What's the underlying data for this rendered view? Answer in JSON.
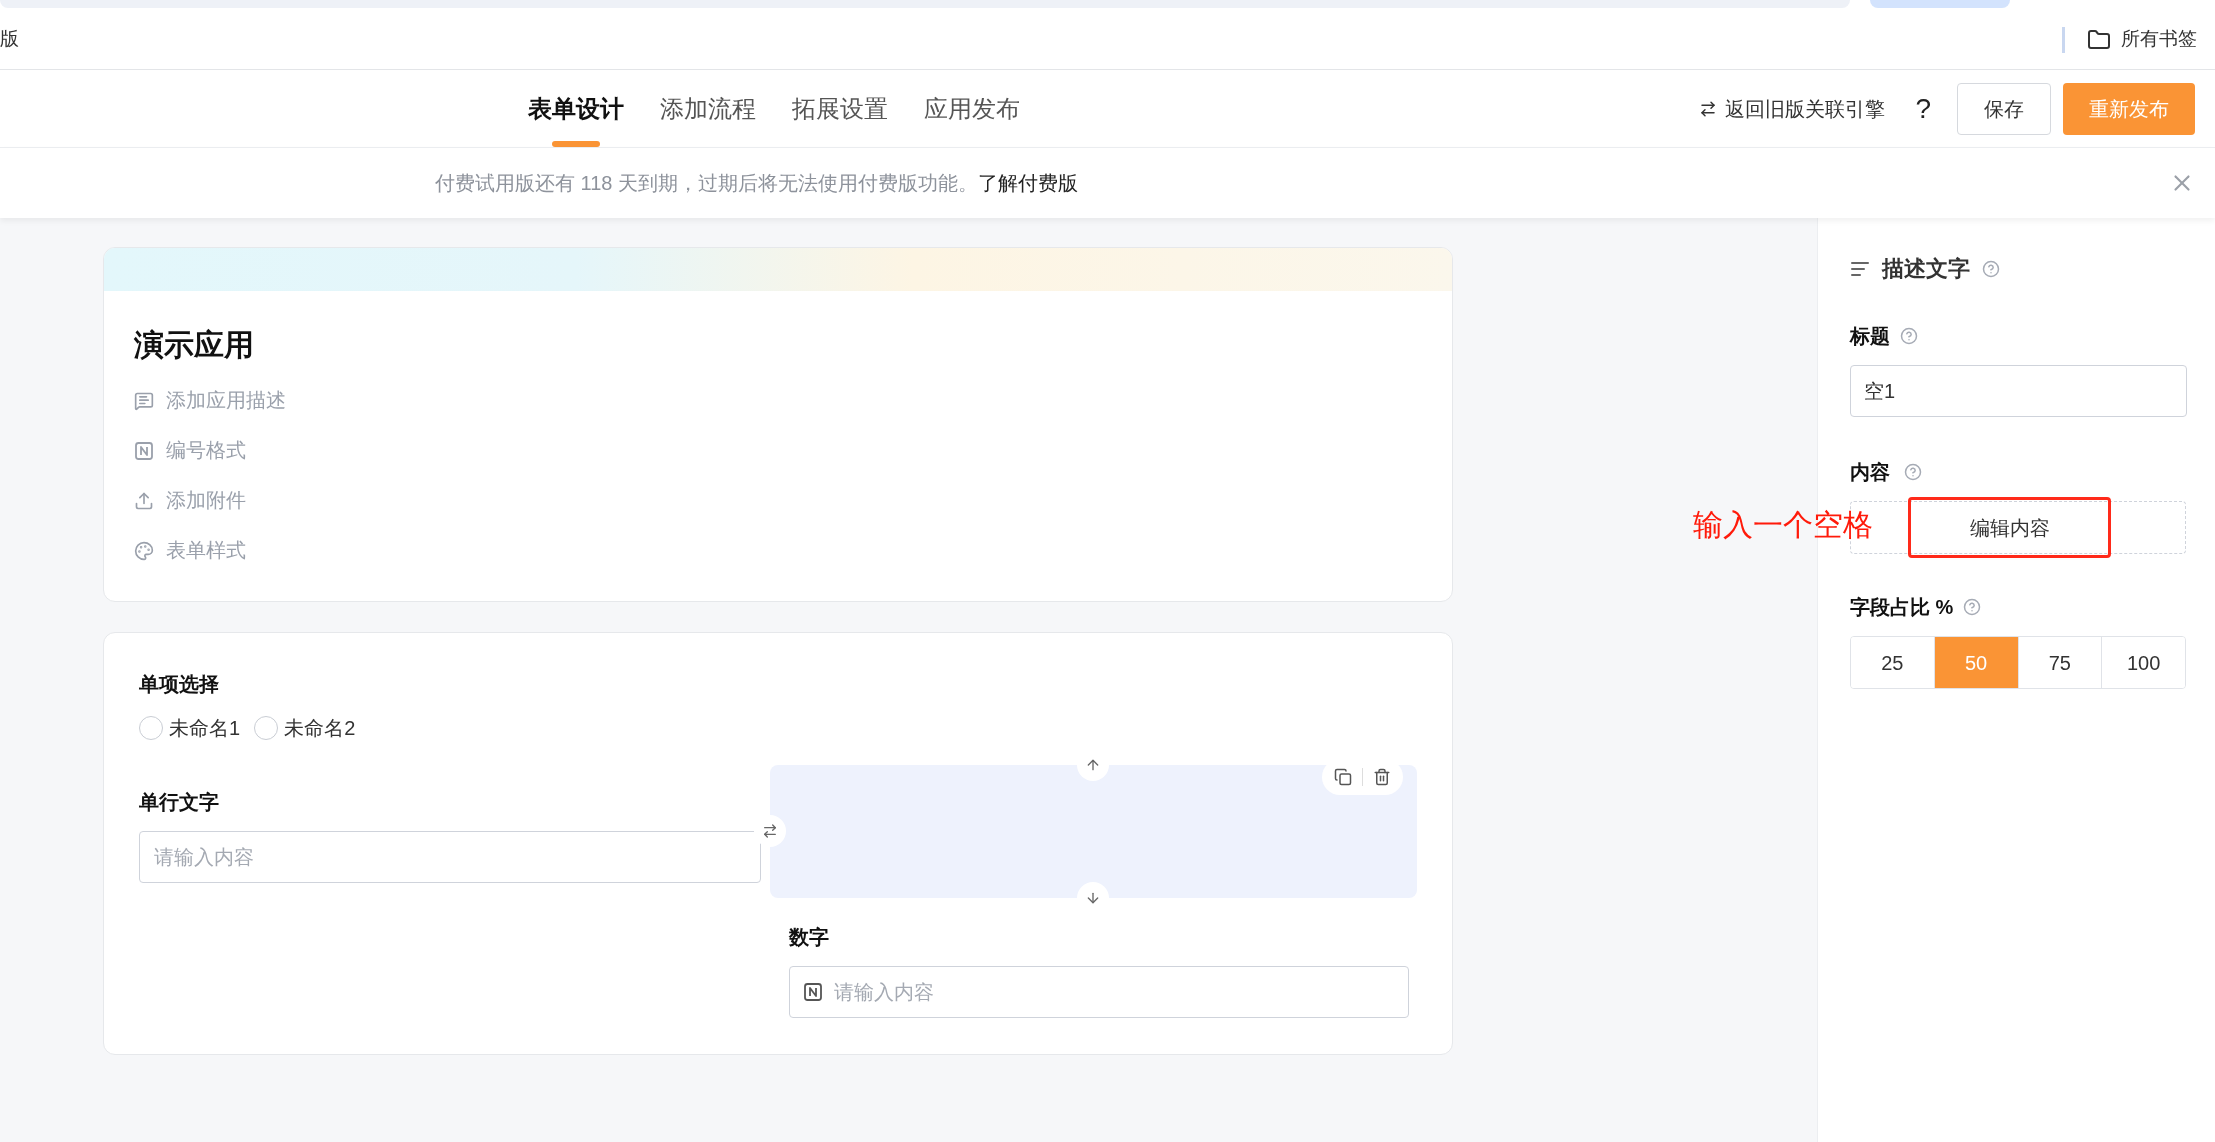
{
  "browser": {
    "bookmark_left": "版",
    "bookmark_folder": "所有书签"
  },
  "header": {
    "tabs": [
      {
        "label": "表单设计",
        "selected": true
      },
      {
        "label": "添加流程",
        "selected": false
      },
      {
        "label": "拓展设置",
        "selected": false
      },
      {
        "label": "应用发布",
        "selected": false
      }
    ],
    "back_link": "返回旧版关联引擎",
    "help": "?",
    "buttons": [
      {
        "label": "保存",
        "kind": "secondary"
      },
      {
        "label": "重新发布",
        "kind": "primary"
      }
    ]
  },
  "banner": {
    "message": "付费试用版还有 118 天到期，过期后将无法使用付费版功能。",
    "link": "了解付费版"
  },
  "app_card": {
    "title": "演示应用",
    "actions": [
      {
        "label": "添加应用描述",
        "kind": "description"
      },
      {
        "label": "编号格式",
        "kind": "numbering"
      },
      {
        "label": "添加附件",
        "kind": "attachment"
      },
      {
        "label": "表单样式",
        "kind": "style"
      }
    ]
  },
  "form": {
    "radio": {
      "label": "单项选择",
      "options": [
        {
          "label": "未命名1",
          "selected": false
        },
        {
          "label": "未命名2",
          "selected": false
        }
      ]
    },
    "text": {
      "label": "单行文字",
      "placeholder": "请输入内容"
    },
    "description": {
      "selected": true
    },
    "number": {
      "label": "数字",
      "placeholder": "请输入内容"
    }
  },
  "panel": {
    "title": "描述文字",
    "title_label": "标题",
    "title_value": "空1",
    "content_label": "内容",
    "edit_button": {
      "label": "编辑内容",
      "highlighted": true
    },
    "width_label": "字段占比 %",
    "width_options": [
      {
        "label": "25",
        "selected": false
      },
      {
        "label": "50",
        "selected": true
      },
      {
        "label": "75",
        "selected": false
      },
      {
        "label": "100",
        "selected": false
      }
    ]
  },
  "annotation": {
    "text": "输入一个空格"
  }
}
